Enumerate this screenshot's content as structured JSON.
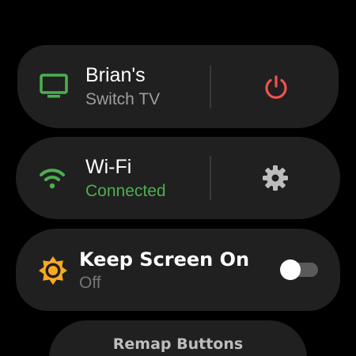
{
  "tv_chip": {
    "title": "Brian's",
    "subtitle": "Switch TV",
    "icon": "tv-icon",
    "action_icon": "power-icon",
    "icon_color": "#4caf50",
    "action_color": "#ef5350"
  },
  "wifi_chip": {
    "title": "Wi-Fi",
    "subtitle": "Connected",
    "icon": "wifi-icon",
    "action_icon": "gear-icon",
    "icon_color": "#4caf50",
    "subtitle_color": "#4caf50"
  },
  "keep_screen_chip": {
    "title": "Keep Screen On",
    "subtitle": "Off",
    "icon": "brightness-icon",
    "icon_color": "#f9a825",
    "toggle_on": false
  },
  "remap_chip": {
    "title": "Remap Buttons"
  }
}
